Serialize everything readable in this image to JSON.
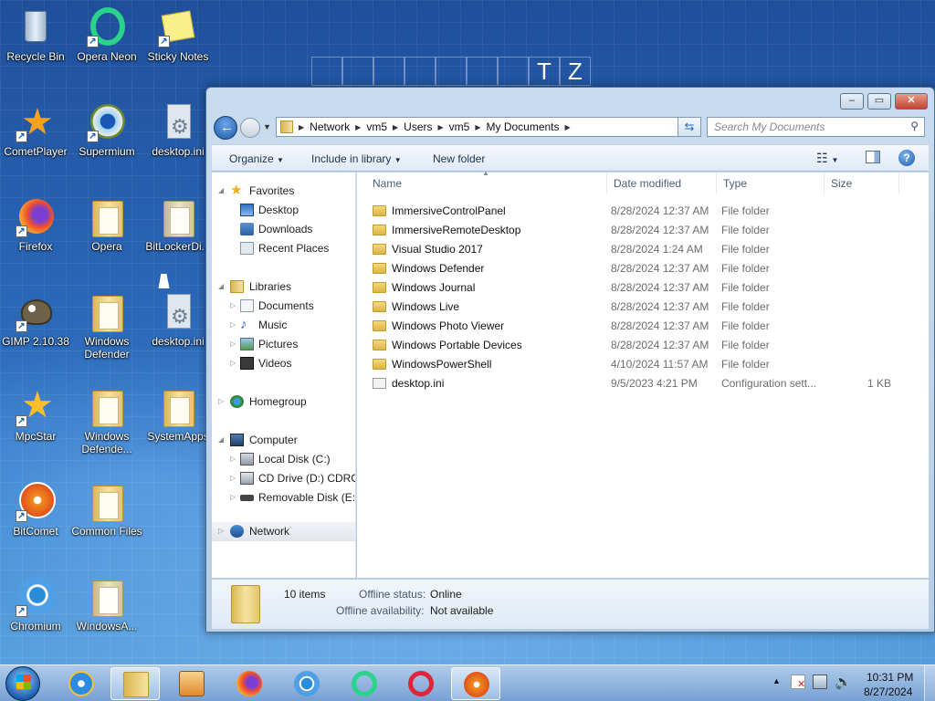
{
  "desktop": {
    "background_text": [
      "T",
      "Z"
    ],
    "icons": [
      {
        "label": "Recycle Bin",
        "icon": "recycle-bin-icon"
      },
      {
        "label": "Opera Neon",
        "icon": "opera-neon-icon"
      },
      {
        "label": "Sticky Notes",
        "icon": "sticky-notes-icon"
      },
      {
        "label": "CometPlayer",
        "icon": "cometplayer-icon"
      },
      {
        "label": "Supermium",
        "icon": "supermium-icon"
      },
      {
        "label": "desktop.ini",
        "icon": "settings-file-icon"
      },
      {
        "label": "Firefox",
        "icon": "firefox-icon"
      },
      {
        "label": "Opera",
        "icon": "folder-icon"
      },
      {
        "label": "BitLockerDi...",
        "icon": "folder-icon"
      },
      {
        "label": "GIMP 2.10.38",
        "icon": "gimp-icon"
      },
      {
        "label": "Windows Defender",
        "icon": "folder-icon"
      },
      {
        "label": "desktop.ini",
        "icon": "settings-file-icon"
      },
      {
        "label": "MpcStar",
        "icon": "mpcstar-icon"
      },
      {
        "label": "Windows Defende...",
        "icon": "folder-icon"
      },
      {
        "label": "SystemApps",
        "icon": "folder-icon"
      },
      {
        "label": "BitComet",
        "icon": "bitcomet-icon"
      },
      {
        "label": "Common Files",
        "icon": "folder-icon"
      },
      {
        "label": "Chromium",
        "icon": "chromium-icon"
      },
      {
        "label": "WindowsA...",
        "icon": "folder-icon"
      }
    ]
  },
  "explorer": {
    "address_crumbs": [
      "Network",
      "vm5",
      "Users",
      "vm5",
      "My Documents"
    ],
    "search_placeholder": "Search My Documents",
    "toolbar": {
      "organize": "Organize",
      "include_in_library": "Include in library",
      "new_folder": "New folder"
    },
    "nav": {
      "favorites": "Favorites",
      "favorites_items": [
        "Desktop",
        "Downloads",
        "Recent Places"
      ],
      "libraries": "Libraries",
      "libraries_items": [
        "Documents",
        "Music",
        "Pictures",
        "Videos"
      ],
      "homegroup": "Homegroup",
      "computer": "Computer",
      "computer_items": [
        "Local Disk (C:)",
        "CD Drive (D:) CDROM",
        "Removable Disk (E:)"
      ],
      "network": "Network"
    },
    "columns": {
      "name": "Name",
      "date": "Date modified",
      "type": "Type",
      "size": "Size"
    },
    "files": [
      {
        "name": "ImmersiveControlPanel",
        "date": "8/28/2024 12:37 AM",
        "type": "File folder",
        "size": "",
        "kind": "folder"
      },
      {
        "name": "ImmersiveRemoteDesktop",
        "date": "8/28/2024 12:37 AM",
        "type": "File folder",
        "size": "",
        "kind": "folder"
      },
      {
        "name": "Visual Studio 2017",
        "date": "8/28/2024 1:24 AM",
        "type": "File folder",
        "size": "",
        "kind": "folder"
      },
      {
        "name": "Windows Defender",
        "date": "8/28/2024 12:37 AM",
        "type": "File folder",
        "size": "",
        "kind": "folder"
      },
      {
        "name": "Windows Journal",
        "date": "8/28/2024 12:37 AM",
        "type": "File folder",
        "size": "",
        "kind": "folder"
      },
      {
        "name": "Windows Live",
        "date": "8/28/2024 12:37 AM",
        "type": "File folder",
        "size": "",
        "kind": "folder"
      },
      {
        "name": "Windows Photo Viewer",
        "date": "8/28/2024 12:37 AM",
        "type": "File folder",
        "size": "",
        "kind": "folder"
      },
      {
        "name": "Windows Portable Devices",
        "date": "8/28/2024 12:37 AM",
        "type": "File folder",
        "size": "",
        "kind": "folder"
      },
      {
        "name": "WindowsPowerShell",
        "date": "4/10/2024 11:57 AM",
        "type": "File folder",
        "size": "",
        "kind": "folder"
      },
      {
        "name": "desktop.ini",
        "date": "9/5/2023 4:21 PM",
        "type": "Configuration sett...",
        "size": "1 KB",
        "kind": "file"
      }
    ],
    "details": {
      "item_count": "10 items",
      "offline_status_label": "Offline status:",
      "offline_status_value": "Online",
      "offline_availability_label": "Offline availability:",
      "offline_availability_value": "Not available"
    }
  },
  "taskbar": {
    "apps": [
      {
        "icon": "start-orb-icon"
      },
      {
        "icon": "internet-explorer-icon"
      },
      {
        "icon": "file-explorer-icon",
        "active": true
      },
      {
        "icon": "media-player-icon"
      },
      {
        "icon": "firefox-icon"
      },
      {
        "icon": "chromium-icon"
      },
      {
        "icon": "opera-neon-icon"
      },
      {
        "icon": "opera-icon"
      },
      {
        "icon": "bitcomet-icon",
        "active": true
      }
    ],
    "clock_time": "10:31 PM",
    "clock_date": "8/27/2024"
  },
  "colors": {
    "accent": "#2b68b8",
    "window_chrome": "#b6cde6",
    "folder": "#e8c35a"
  }
}
